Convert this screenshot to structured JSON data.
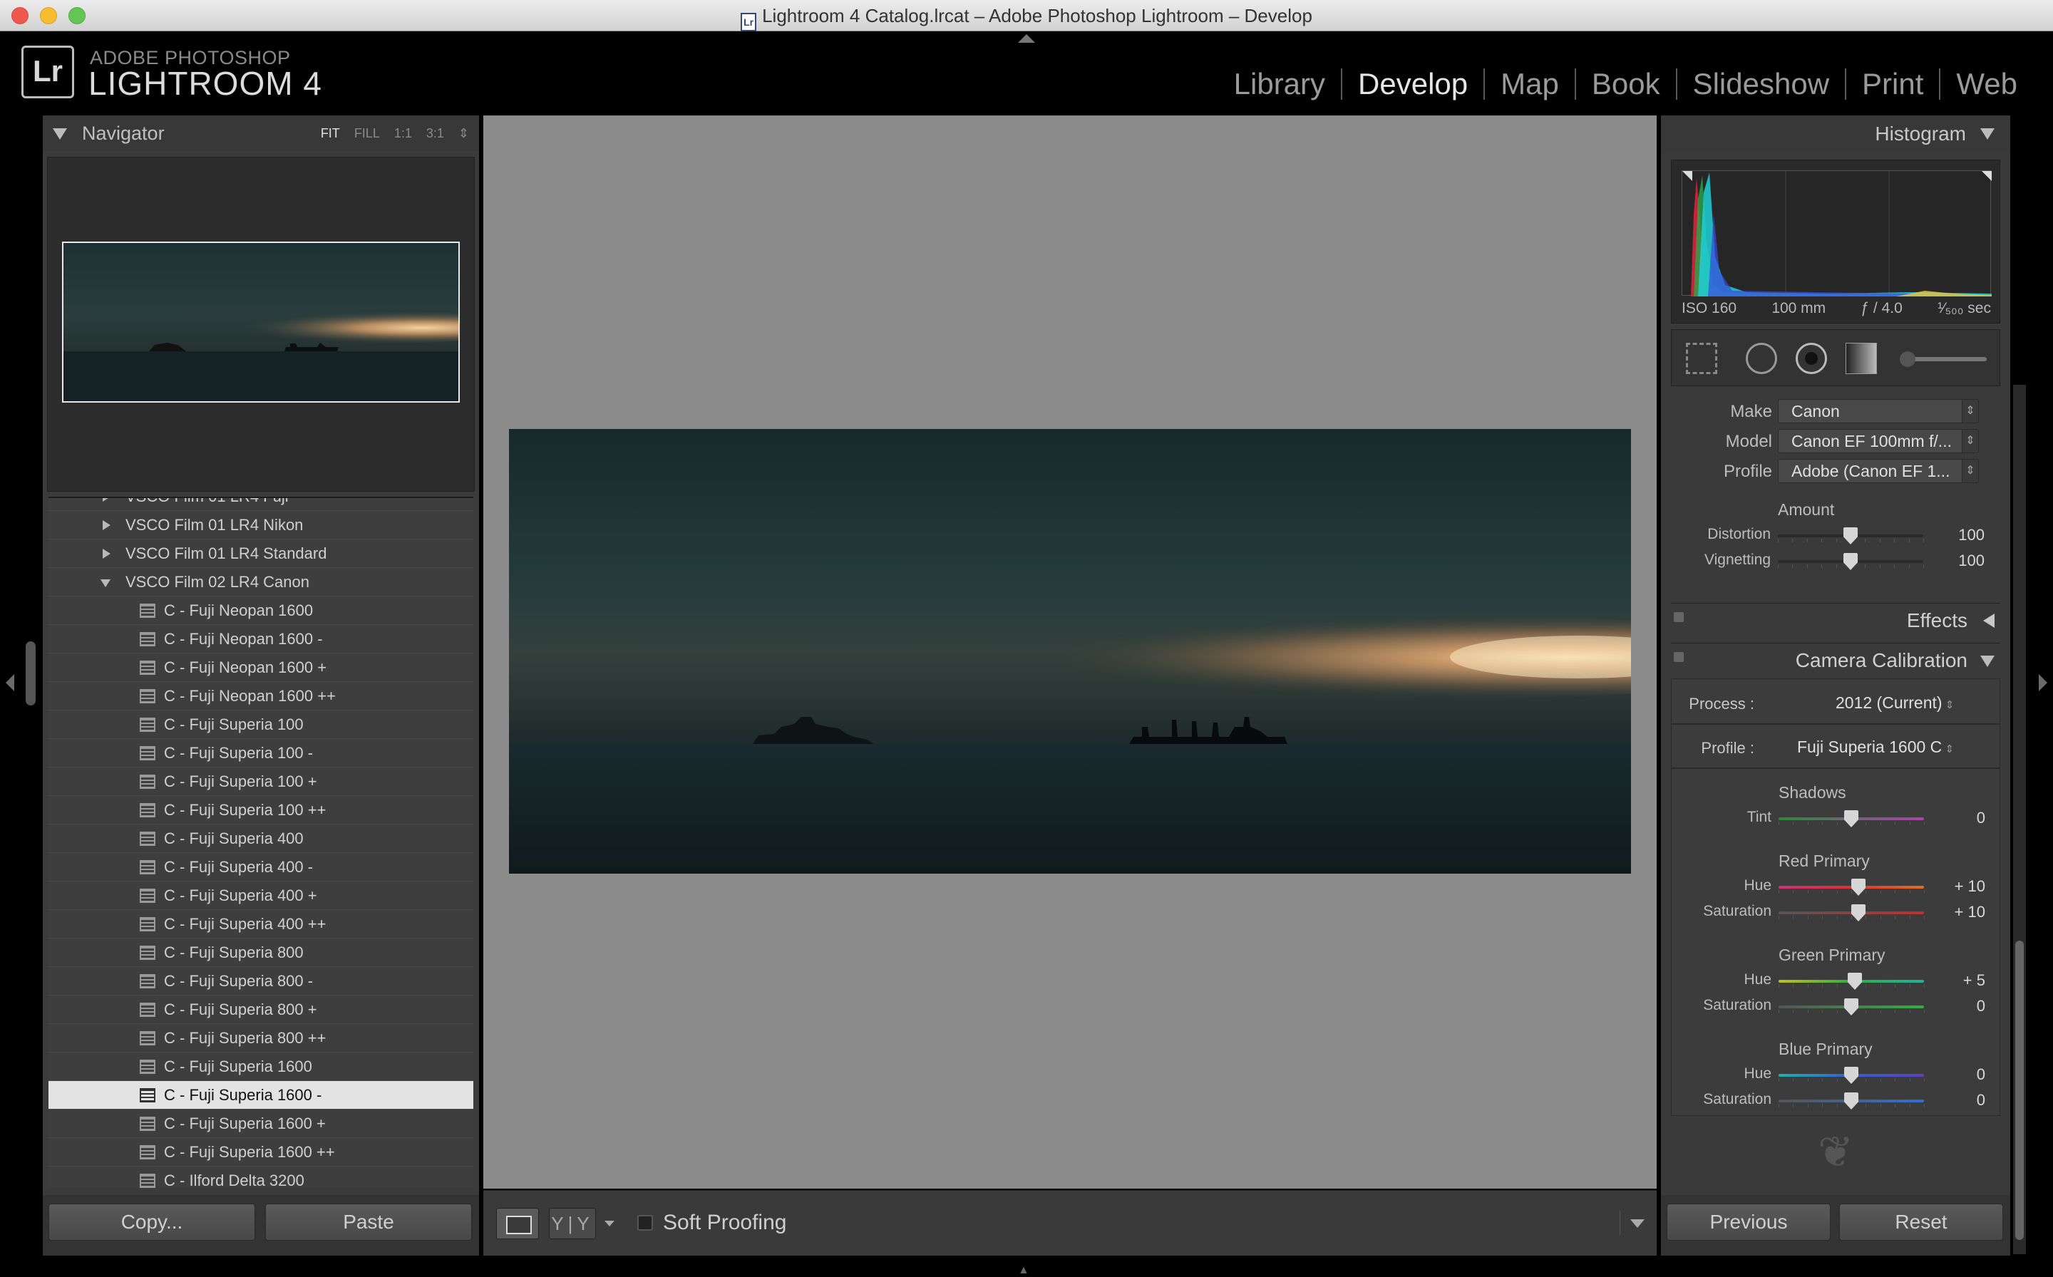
{
  "window": {
    "title": "Lightroom 4 Catalog.lrcat – Adobe Photoshop Lightroom – Develop",
    "doc_icon": "Lr"
  },
  "identity": {
    "logo": "Lr",
    "product_small": "ADOBE PHOTOSHOP",
    "product_big": "LIGHTROOM 4"
  },
  "modules": [
    {
      "label": "Library",
      "active": false
    },
    {
      "label": "Develop",
      "active": true
    },
    {
      "label": "Map",
      "active": false
    },
    {
      "label": "Book",
      "active": false
    },
    {
      "label": "Slideshow",
      "active": false
    },
    {
      "label": "Print",
      "active": false
    },
    {
      "label": "Web",
      "active": false
    }
  ],
  "navigator": {
    "title": "Navigator",
    "zoom": [
      "FIT",
      "FILL",
      "1:1",
      "3:1"
    ],
    "zoom_active": "FIT"
  },
  "presets": {
    "partial_top": "VSCO Film 01 LR4 Fuji",
    "folders": [
      {
        "label": "VSCO Film 01 LR4 Nikon",
        "open": false
      },
      {
        "label": "VSCO Film 01 LR4 Standard",
        "open": false
      },
      {
        "label": "VSCO Film 02 LR4 Canon",
        "open": true
      }
    ],
    "items": [
      "C - Fuji Neopan 1600",
      "C - Fuji Neopan 1600 -",
      "C - Fuji Neopan 1600 +",
      "C - Fuji Neopan 1600 ++",
      "C - Fuji Superia 100",
      "C - Fuji Superia 100 -",
      "C - Fuji Superia 100 +",
      "C - Fuji Superia 100 ++",
      "C - Fuji Superia 400",
      "C - Fuji Superia 400 -",
      "C - Fuji Superia 400 +",
      "C - Fuji Superia 400 ++",
      "C - Fuji Superia 800",
      "C - Fuji Superia 800 -",
      "C - Fuji Superia 800 +",
      "C - Fuji Superia 800 ++",
      "C - Fuji Superia 1600",
      "C - Fuji Superia 1600 -",
      "C - Fuji Superia 1600 +",
      "C - Fuji Superia 1600 ++",
      "C - Ilford Delta 3200"
    ],
    "selected": "C - Fuji Superia 1600 -"
  },
  "left_footer": {
    "copy": "Copy...",
    "paste": "Paste"
  },
  "toolbar": {
    "before_after": "Y|Y",
    "soft_proofing": "Soft Proofing"
  },
  "histogram": {
    "title": "Histogram",
    "iso": "ISO 160",
    "focal": "100 mm",
    "aperture": "ƒ / 4.0",
    "shutter": "¹⁄₅₀₀ sec"
  },
  "lens": {
    "make_label": "Make",
    "make": "Canon",
    "model_label": "Model",
    "model": "Canon EF 100mm f/...",
    "profile_label": "Profile",
    "profile": "Adobe (Canon EF 1...",
    "amount_label": "Amount",
    "distortion_label": "Distortion",
    "distortion": "100",
    "vignetting_label": "Vignetting",
    "vignetting": "100"
  },
  "sections": {
    "effects": "Effects",
    "calibration": "Camera Calibration"
  },
  "calibration": {
    "process_label": "Process :",
    "process": "2012 (Current)",
    "profile_label": "Profile :",
    "profile": "Fuji Superia 1600 C",
    "shadows": "Shadows",
    "tint_label": "Tint",
    "tint": "0",
    "red": "Red Primary",
    "red_hue_label": "Hue",
    "red_hue": "+ 10",
    "red_sat_label": "Saturation",
    "red_sat": "+ 10",
    "green": "Green Primary",
    "green_hue_label": "Hue",
    "green_hue": "+ 5",
    "green_sat_label": "Saturation",
    "green_sat": "0",
    "blue": "Blue Primary",
    "blue_hue_label": "Hue",
    "blue_hue": "0",
    "blue_sat_label": "Saturation",
    "blue_sat": "0"
  },
  "slider_levels": {
    "distortion": 0.5,
    "vignetting": 0.5,
    "tint": 0.5,
    "red_hue": 0.55,
    "red_sat": 0.55,
    "green_hue": 0.525,
    "green_sat": 0.5,
    "blue_hue": 0.5,
    "blue_sat": 0.5
  },
  "right_footer": {
    "previous": "Previous",
    "reset": "Reset"
  }
}
